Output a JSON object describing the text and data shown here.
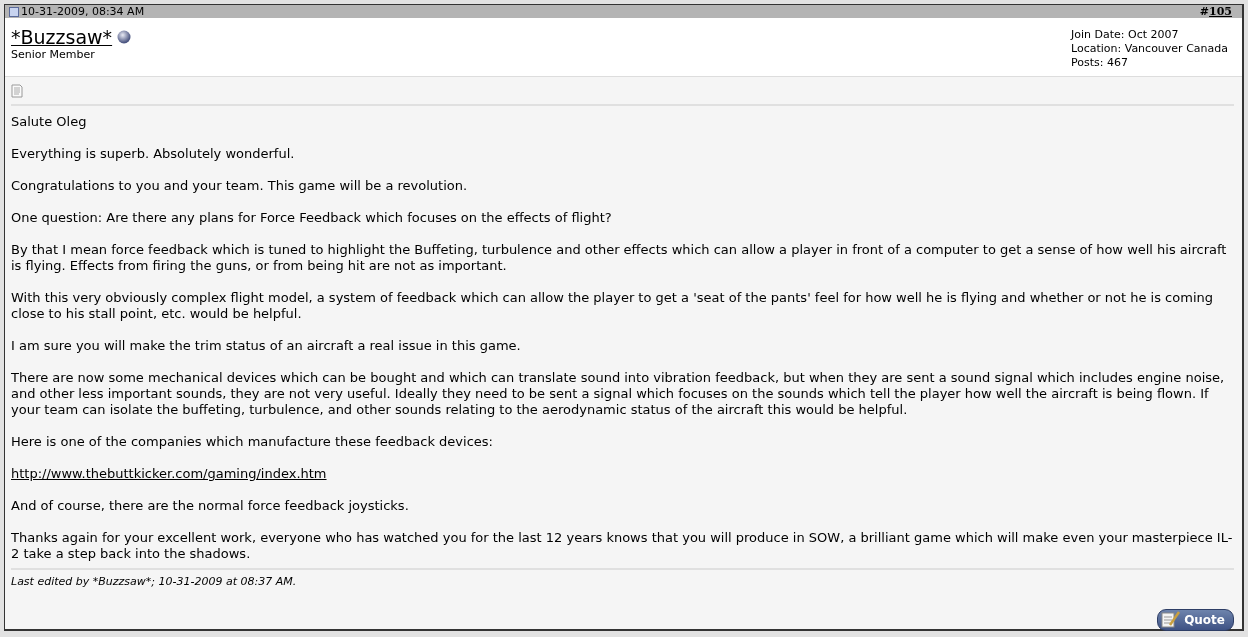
{
  "header": {
    "date": "10-31-2009, 08:34 AM",
    "post_number_prefix": "#",
    "post_number": "105"
  },
  "user": {
    "name": "*Buzzsaw*",
    "title": "Senior Member",
    "online": false
  },
  "user_info": [
    "Join Date: Oct 2007",
    "Location: Vancouver Canada",
    "Posts: 467"
  ],
  "paragraphs": [
    {
      "kind": "text",
      "text": "Salute Oleg"
    },
    {
      "kind": "text",
      "text": "Everything is superb. Absolutely wonderful."
    },
    {
      "kind": "text",
      "text": "Congratulations to you and your team. This game will be a revolution."
    },
    {
      "kind": "text",
      "text": "One question: Are there any plans for Force Feedback which focuses on the effects of flight?"
    },
    {
      "kind": "text",
      "text": "By that I mean force feedback which is tuned to highlight the Buffeting, turbulence and other effects which can allow a player in front of a computer to get a sense of how well his aircraft is flying. Effects from firing the guns, or from being hit are not as important."
    },
    {
      "kind": "text",
      "text": "With this very obviously complex flight model, a system of feedback which can allow the player to get a 'seat of the pants' feel for how well he is flying and whether or not he is coming close to his stall point, etc. would be helpful."
    },
    {
      "kind": "text",
      "text": "I am sure you will make the trim status of an aircraft a real issue in this game."
    },
    {
      "kind": "text",
      "text": "There are now some mechanical devices which can be bought and which can translate sound into vibration feedback, but when they are sent a sound signal which includes engine noise, and other less important sounds, they are not very useful. Ideally they need to be sent a signal which focuses on the sounds which tell the player how well the aircraft is being flown. If your team can isolate the buffeting, turbulence, and other sounds relating to the aerodynamic status of the aircraft this would be helpful."
    },
    {
      "kind": "text",
      "text": "Here is one of the companies which manufacture these feedback devices:"
    },
    {
      "kind": "link",
      "text": "http://www.thebuttkicker.com/gaming/index.htm"
    },
    {
      "kind": "text",
      "text": "And of course, there are the normal force feedback joysticks."
    },
    {
      "kind": "text",
      "text": "Thanks again for your excellent work, everyone who has watched you for the last 12 years knows that you will produce in SOW, a brilliant game which will make even your masterpiece IL-2 take a step back into the shadows."
    }
  ],
  "edit_note": "Last edited by *Buzzsaw*; 10-31-2009 at 08:37 AM.",
  "quote_button": "Quote"
}
